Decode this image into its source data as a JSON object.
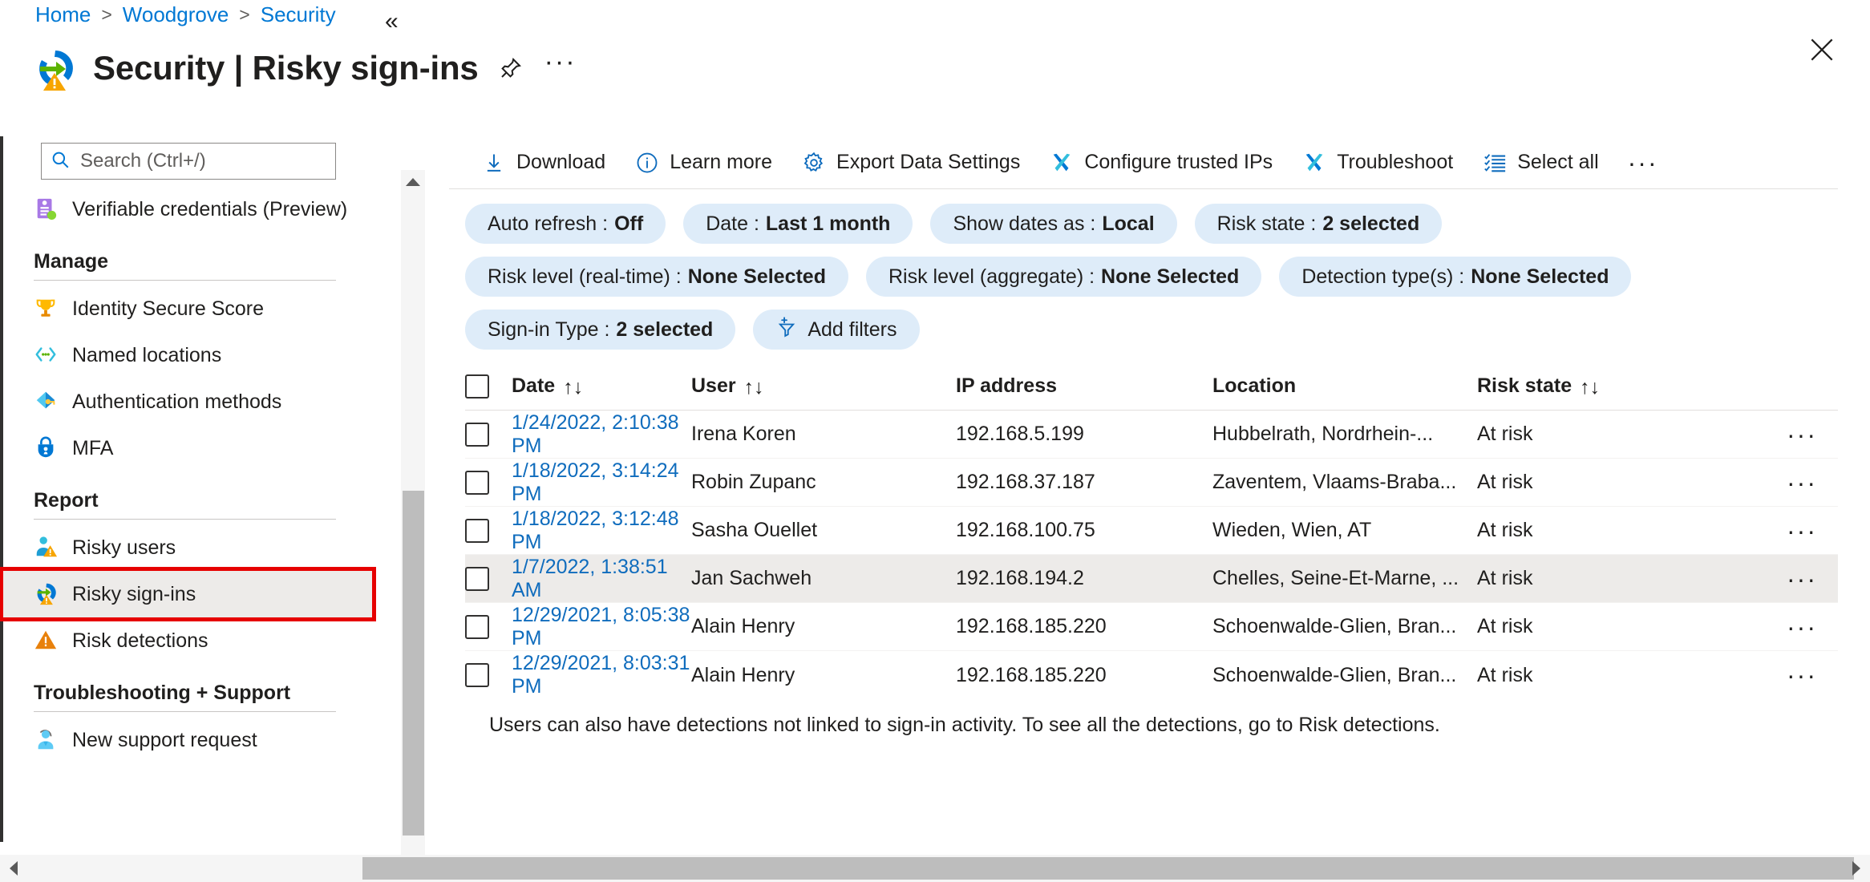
{
  "breadcrumb": {
    "items": [
      "Home",
      "Woodgrove",
      "Security"
    ]
  },
  "header": {
    "title": "Security | Risky sign-ins",
    "pin_label": "Pin",
    "more_label": "More",
    "close_label": "Close"
  },
  "sidebar": {
    "search": {
      "placeholder": "Search (Ctrl+/)",
      "value": ""
    },
    "collapse_label": "«",
    "top_items": [
      {
        "label": "Verifiable credentials (Preview)",
        "icon": "verifiable-credentials-icon"
      }
    ],
    "sections": [
      {
        "title": "Manage",
        "items": [
          {
            "label": "Identity Secure Score",
            "icon": "trophy-icon"
          },
          {
            "label": "Named locations",
            "icon": "named-locations-icon"
          },
          {
            "label": "Authentication methods",
            "icon": "authentication-methods-icon"
          },
          {
            "label": "MFA",
            "icon": "mfa-lock-icon"
          }
        ]
      },
      {
        "title": "Report",
        "items": [
          {
            "label": "Risky users",
            "icon": "risky-users-icon"
          },
          {
            "label": "Risky sign-ins",
            "icon": "risky-signins-icon"
          },
          {
            "label": "Risk detections",
            "icon": "risk-detections-icon"
          }
        ]
      },
      {
        "title": "Troubleshooting + Support",
        "items": [
          {
            "label": "New support request",
            "icon": "support-agent-icon"
          }
        ]
      }
    ]
  },
  "toolbar": {
    "buttons": [
      {
        "label": "Download",
        "icon": "download-icon"
      },
      {
        "label": "Learn more",
        "icon": "info-icon"
      },
      {
        "label": "Export Data Settings",
        "icon": "gear-icon"
      },
      {
        "label": "Configure trusted IPs",
        "icon": "tools-icon"
      },
      {
        "label": "Troubleshoot",
        "icon": "tools-icon"
      },
      {
        "label": "Select all",
        "icon": "checklist-icon"
      }
    ],
    "more_label": "···"
  },
  "filters": {
    "rows": [
      [
        {
          "label": "Auto refresh :",
          "value": "Off"
        },
        {
          "label": "Date :",
          "value": "Last 1 month"
        },
        {
          "label": "Show dates as :",
          "value": "Local"
        },
        {
          "label": "Risk state :",
          "value": "2 selected"
        }
      ],
      [
        {
          "label": "Risk level (real-time) :",
          "value": "None Selected"
        },
        {
          "label": "Risk level (aggregate) :",
          "value": "None Selected"
        },
        {
          "label": "Detection type(s) :",
          "value": "None Selected"
        }
      ],
      [
        {
          "label": "Sign-in Type :",
          "value": "2 selected"
        }
      ]
    ],
    "add_filters_label": "Add filters"
  },
  "table": {
    "columns": [
      {
        "label": "Date",
        "sortable": true
      },
      {
        "label": "User",
        "sortable": true
      },
      {
        "label": "IP address",
        "sortable": false
      },
      {
        "label": "Location",
        "sortable": false
      },
      {
        "label": "Risk state",
        "sortable": true
      }
    ],
    "sort_glyph": "↑↓",
    "rows": [
      {
        "date": "1/24/2022, 2:10:38 PM",
        "user": "Irena Koren",
        "ip": "192.168.5.199",
        "location": "Hubbelrath, Nordrhein-...",
        "risk_state": "At risk",
        "selected": false
      },
      {
        "date": "1/18/2022, 3:14:24 PM",
        "user": "Robin Zupanc",
        "ip": "192.168.37.187",
        "location": "Zaventem, Vlaams-Braba...",
        "risk_state": "At risk",
        "selected": false
      },
      {
        "date": "1/18/2022, 3:12:48 PM",
        "user": "Sasha Ouellet",
        "ip": "192.168.100.75",
        "location": "Wieden, Wien, AT",
        "risk_state": "At risk",
        "selected": false
      },
      {
        "date": "1/7/2022, 1:38:51 AM",
        "user": "Jan Sachweh",
        "ip": "192.168.194.2",
        "location": "Chelles, Seine-Et-Marne, ...",
        "risk_state": "At risk",
        "selected": true
      },
      {
        "date": "12/29/2021, 8:05:38 PM",
        "user": "Alain Henry",
        "ip": "192.168.185.220",
        "location": "Schoenwalde-Glien, Bran...",
        "risk_state": "At risk",
        "selected": false
      },
      {
        "date": "12/29/2021, 8:03:31 PM",
        "user": "Alain Henry",
        "ip": "192.168.185.220",
        "location": "Schoenwalde-Glien, Bran...",
        "risk_state": "At risk",
        "selected": false
      }
    ],
    "row_more_label": "···",
    "note": "Users can also have detections not linked to sign-in activity. To see all the detections, go to Risk detections."
  },
  "colors": {
    "link": "#0f6cbd",
    "breadcrumb_link": "#0078d4",
    "pill_bg": "#deecf9",
    "selected_row": "#edebe9",
    "highlight_outline": "#e60000",
    "azure_blue": "#0078d4",
    "warning_orange": "#f7a500"
  }
}
